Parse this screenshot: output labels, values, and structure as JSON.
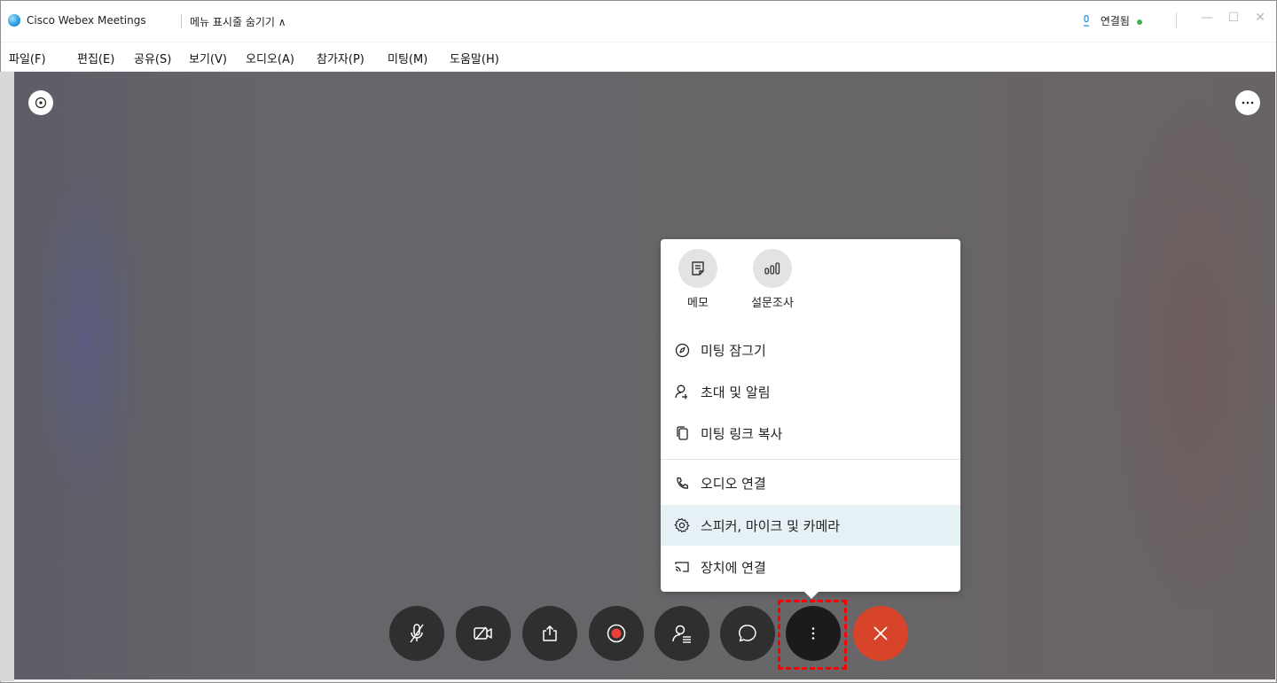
{
  "window": {
    "app_title": "Cisco Webex Meetings",
    "menu_toggle": "메뉴 표시줄 숨기기 ∧",
    "connection_status": "연결됨",
    "minimize_glyph": "—",
    "maximize_glyph": "☐",
    "close_glyph": "✕"
  },
  "menubar": {
    "items": [
      "파일(F)",
      "편집(E)",
      "공유(S)",
      "보기(V)",
      "오디오(A)",
      "참가자(P)",
      "미팅(M)",
      "도움말(H)"
    ]
  },
  "overlay": {
    "info_icon": "info-icon",
    "more_icon": "more-horizontal-icon"
  },
  "popup": {
    "quick_actions": [
      {
        "label": "메모",
        "icon": "notes-icon"
      },
      {
        "label": "설문조사",
        "icon": "polling-icon"
      }
    ],
    "items": [
      {
        "label": "미팅 잠그기",
        "icon": "lock-compass-icon"
      },
      {
        "label": "초대 및 알림",
        "icon": "add-person-icon"
      },
      {
        "label": "미팅 링크 복사",
        "icon": "copy-icon"
      },
      {
        "label": "오디오 연결",
        "icon": "phone-icon"
      },
      {
        "label": "스피커, 마이크 및 카메라",
        "icon": "gear-icon",
        "highlighted": true
      },
      {
        "label": "장치에 연결",
        "icon": "cast-icon"
      }
    ]
  },
  "controls": {
    "buttons": [
      {
        "name": "mute",
        "icon": "mic-off-icon"
      },
      {
        "name": "video",
        "icon": "video-off-icon"
      },
      {
        "name": "share",
        "icon": "share-icon"
      },
      {
        "name": "record",
        "icon": "record-icon"
      },
      {
        "name": "participants",
        "icon": "participants-icon"
      },
      {
        "name": "chat",
        "icon": "chat-icon"
      },
      {
        "name": "more",
        "icon": "more-vertical-icon"
      },
      {
        "name": "end",
        "icon": "close-icon"
      }
    ],
    "colors": {
      "control_bg": "#2f2f2f",
      "end_bg": "#d7442a",
      "highlight_border": "#ff0000"
    }
  }
}
